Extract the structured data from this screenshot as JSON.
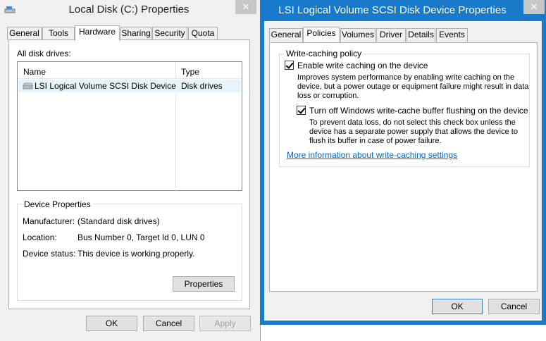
{
  "left_window": {
    "title": "Local Disk (C:) Properties",
    "close_glyph": "✕",
    "tabs": [
      "General",
      "Tools",
      "Hardware",
      "Sharing",
      "Security",
      "Quota"
    ],
    "active_tab": "Hardware",
    "all_disk_drives_label": "All disk drives:",
    "list": {
      "columns": [
        "Name",
        "Type"
      ],
      "rows": [
        {
          "name": "LSI Logical Volume SCSI Disk Device",
          "type": "Disk drives"
        }
      ]
    },
    "device_properties": {
      "title": "Device Properties",
      "fields": [
        {
          "label": "Manufacturer:",
          "value": "(Standard disk drives)"
        },
        {
          "label": "Location:",
          "value": "Bus Number 0, Target Id 0, LUN 0"
        },
        {
          "label": "Device status:",
          "value": "This device is working properly."
        }
      ],
      "properties_button": "Properties"
    },
    "buttons": {
      "ok": "OK",
      "cancel": "Cancel",
      "apply": "Apply"
    }
  },
  "right_window": {
    "title": "LSI Logical Volume SCSI Disk Device Properties",
    "close_glyph": "✕",
    "tabs": [
      "General",
      "Policies",
      "Volumes",
      "Driver",
      "Details",
      "Events"
    ],
    "active_tab": "Policies",
    "write_caching": {
      "title": "Write-caching policy",
      "enable": {
        "checked": true,
        "label": "Enable write caching on the device",
        "desc_lines": [
          "Improves system performance by enabling write caching on the",
          "device, but a power outage or equipment failure might result in data",
          "loss or corruption."
        ]
      },
      "turn_off_flush": {
        "checked": true,
        "label": "Turn off Windows write-cache buffer flushing on the device",
        "desc_lines": [
          "To prevent data loss, do not select this check box unless the",
          "device has a separate power supply that allows the device to",
          "flush its buffer in case of power failure."
        ]
      },
      "more_info_link": "More information about write-caching settings"
    },
    "buttons": {
      "ok": "OK",
      "cancel": "Cancel"
    }
  },
  "colors": {
    "active_title_bar": "#1979ca",
    "window_background": "#f0f0f0",
    "link": "#0066cc",
    "selected_row": "#e5f3fb"
  }
}
